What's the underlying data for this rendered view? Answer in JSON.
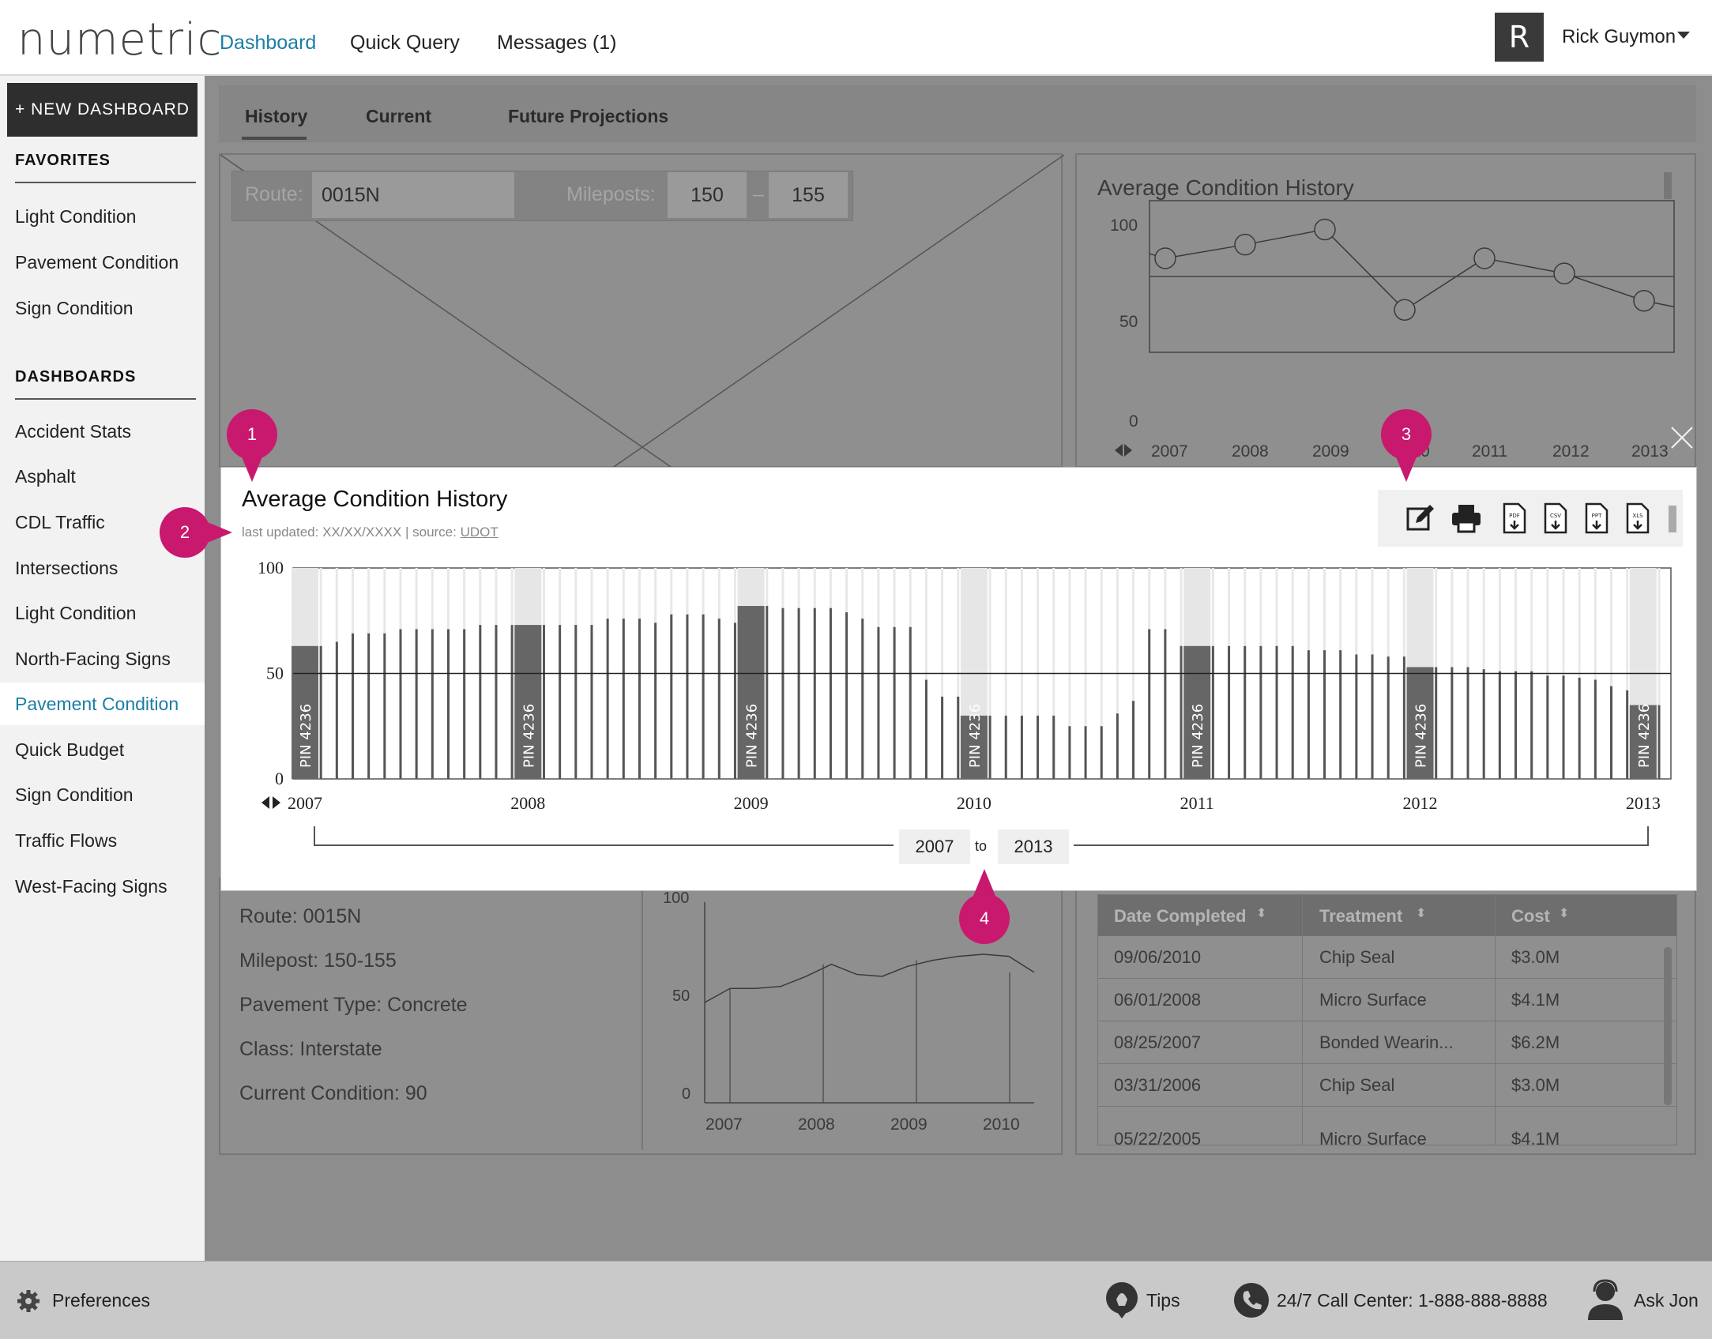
{
  "header": {
    "logo": "numetric",
    "nav": [
      "Dashboard",
      "Quick Query",
      "Messages (1)"
    ],
    "user_initial": "R",
    "user_name": "Rick Guymon"
  },
  "sidebar": {
    "new_dashboard": "+ NEW DASHBOARD",
    "favorites_title": "FAVORITES",
    "favorites": [
      "Light Condition",
      "Pavement Condition",
      "Sign Condition"
    ],
    "dashboards_title": "DASHBOARDS",
    "dashboards": [
      "Accident Stats",
      "Asphalt",
      "CDL Traffic",
      "Intersections",
      "Light Condition",
      "North-Facing Signs",
      "Pavement Condition",
      "Quick Budget",
      "Sign Condition",
      "Traffic Flows",
      "West-Facing Signs"
    ],
    "active_item": "Pavement Condition"
  },
  "tabs": [
    "History",
    "Current",
    "Future Projections"
  ],
  "map_panel": {
    "route_label": "Route:",
    "route_value": "0015N",
    "mileposts_label": "Mileposts:",
    "mile_from": "150",
    "mile_sep": "–",
    "mile_to": "155"
  },
  "bg_chart": {
    "title": "Average Condition History",
    "y_ticks": [
      "100",
      "50",
      "0"
    ],
    "years": [
      "2007",
      "2008",
      "2009",
      "2010",
      "2011",
      "2012",
      "2013"
    ]
  },
  "info_panel": {
    "lines": [
      "Route:  0015N",
      "Milepost: 150-155",
      "Pavement Type: Concrete",
      "Class: Interstate",
      "Current Condition: 90"
    ]
  },
  "small_chart": {
    "y_ticks": [
      "100",
      "50",
      "0"
    ],
    "years": [
      "2007",
      "2008",
      "2009",
      "2010"
    ]
  },
  "table": {
    "columns": [
      "Date Completed",
      "Treatment",
      "Cost"
    ],
    "rows": [
      [
        "09/06/2010",
        "Chip Seal",
        "$3.0M"
      ],
      [
        "06/01/2008",
        "Micro Surface",
        "$4.1M"
      ],
      [
        "08/25/2007",
        "Bonded Wearin...",
        "$6.2M"
      ],
      [
        "03/31/2006",
        "Chip Seal",
        "$3.0M"
      ],
      [
        "05/22/2005",
        "Micro Surface",
        "$4.1M"
      ]
    ]
  },
  "modal": {
    "title": "Average Condition History",
    "last_updated": "last updated: XX/XX/XXXX",
    "source_label": "| source:",
    "source_link": "UDOT",
    "range_from": "2007",
    "range_to_label": "to",
    "range_to": "2013",
    "tools": [
      "edit-icon",
      "print-icon",
      "pdf-download-icon",
      "csv-download-icon",
      "ppt-download-icon",
      "xls-download-icon"
    ],
    "tool_labels": [
      "PDF",
      "CSV",
      "PPT",
      "XLS"
    ]
  },
  "markers": [
    "1",
    "2",
    "3",
    "4"
  ],
  "footer": {
    "preferences": "Preferences",
    "tips": "Tips",
    "call_center": "24/7 Call Center: 1-888-888-8888",
    "ask": "Ask Jon"
  },
  "chart_data": {
    "type": "bar",
    "title": "Average Condition History",
    "ylim": [
      0,
      100
    ],
    "y_ticks": [
      "100",
      "50",
      "0"
    ],
    "x_tick_labels": [
      "2007",
      "2008",
      "2009",
      "2010",
      "2011",
      "2012",
      "2013"
    ],
    "highlight_label": "PIN 4236",
    "highlight_indices": [
      0,
      14,
      28,
      42,
      56,
      70,
      84
    ],
    "colors": {
      "bar": "#555555",
      "highlight": "#666666",
      "highlight_bg": "#e6e6e6"
    },
    "values": [
      63,
      63,
      65,
      69,
      69,
      69,
      71,
      71,
      71,
      71,
      71,
      73,
      73,
      73,
      73,
      73,
      73,
      73,
      73,
      76,
      76,
      76,
      74,
      78,
      78,
      78,
      76,
      74,
      82,
      82,
      81,
      81,
      81,
      81,
      79,
      76,
      72,
      72,
      72,
      47,
      39,
      39,
      30,
      30,
      30,
      30,
      30,
      30,
      25,
      25,
      25,
      31,
      37,
      71,
      71,
      63,
      63,
      63,
      63,
      63,
      63,
      63,
      63,
      61,
      61,
      61,
      59,
      59,
      58,
      58,
      53,
      53,
      53,
      53,
      52,
      51,
      51,
      51,
      49,
      49,
      48,
      47,
      44,
      42,
      35,
      35
    ]
  },
  "bg_line_data": {
    "type": "line",
    "values": [
      65,
      62,
      71,
      81,
      28,
      62,
      52,
      34,
      30
    ]
  },
  "small_line_data": {
    "type": "area",
    "values": [
      50,
      57,
      57,
      58,
      63,
      69,
      64,
      63,
      68,
      71,
      73,
      74,
      73,
      65
    ]
  }
}
